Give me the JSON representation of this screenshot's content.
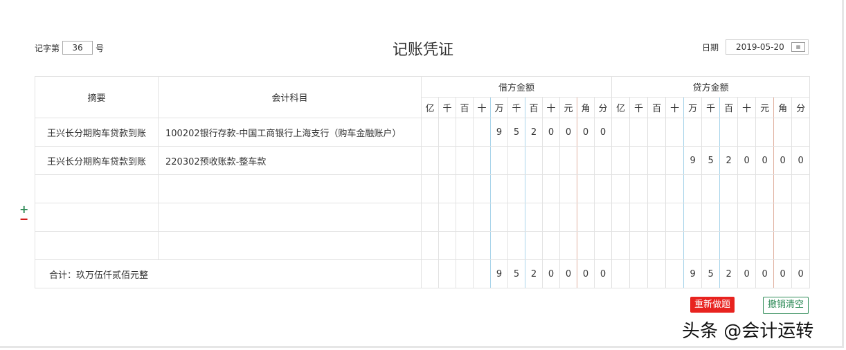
{
  "header": {
    "prefix": "记字第",
    "number": "36",
    "suffix": "号",
    "title": "记账凭证",
    "date_label": "日期",
    "date": "2019-05-20"
  },
  "columns": {
    "summary": "摘要",
    "account": "会计科目",
    "debit": "借方金额",
    "credit": "贷方金额",
    "digits": [
      "亿",
      "千",
      "百",
      "十",
      "万",
      "千",
      "百",
      "十",
      "元",
      "角",
      "分"
    ]
  },
  "rows": [
    {
      "summary": "王兴长分期购车贷款到账",
      "account": "100202银行存款-中国工商银行上海支行（购车金融账户）",
      "debit": [
        "",
        "",
        "",
        "",
        "9",
        "5",
        "2",
        "0",
        "0",
        "0",
        "0"
      ],
      "credit": [
        "",
        "",
        "",
        "",
        "",
        "",
        "",
        "",
        "",
        "",
        ""
      ]
    },
    {
      "summary": "王兴长分期购车贷款到账",
      "account": "220302预收账款-整车款",
      "debit": [
        "",
        "",
        "",
        "",
        "",
        "",
        "",
        "",
        "",
        "",
        ""
      ],
      "credit": [
        "",
        "",
        "",
        "",
        "9",
        "5",
        "2",
        "0",
        "0",
        "0",
        "0"
      ]
    },
    {
      "summary": "",
      "account": "",
      "debit": [
        "",
        "",
        "",
        "",
        "",
        "",
        "",
        "",
        "",
        "",
        ""
      ],
      "credit": [
        "",
        "",
        "",
        "",
        "",
        "",
        "",
        "",
        "",
        "",
        ""
      ]
    },
    {
      "summary": "",
      "account": "",
      "debit": [
        "",
        "",
        "",
        "",
        "",
        "",
        "",
        "",
        "",
        "",
        ""
      ],
      "credit": [
        "",
        "",
        "",
        "",
        "",
        "",
        "",
        "",
        "",
        "",
        ""
      ]
    },
    {
      "summary": "",
      "account": "",
      "debit": [
        "",
        "",
        "",
        "",
        "",
        "",
        "",
        "",
        "",
        "",
        ""
      ],
      "credit": [
        "",
        "",
        "",
        "",
        "",
        "",
        "",
        "",
        "",
        "",
        ""
      ]
    }
  ],
  "total": {
    "label": "合计：玖万伍仟贰佰元整",
    "debit": [
      "",
      "",
      "",
      "",
      "9",
      "5",
      "2",
      "0",
      "0",
      "0",
      "0"
    ],
    "credit": [
      "",
      "",
      "",
      "",
      "9",
      "5",
      "2",
      "0",
      "0",
      "0",
      "0"
    ]
  },
  "controls": {
    "add": "+",
    "remove": "−",
    "redo": "重新做题",
    "clear": "撤销清空"
  },
  "watermark": "头条 @会计运转",
  "colors": {
    "red_button": "#e8231f",
    "green": "#2e8b57"
  }
}
